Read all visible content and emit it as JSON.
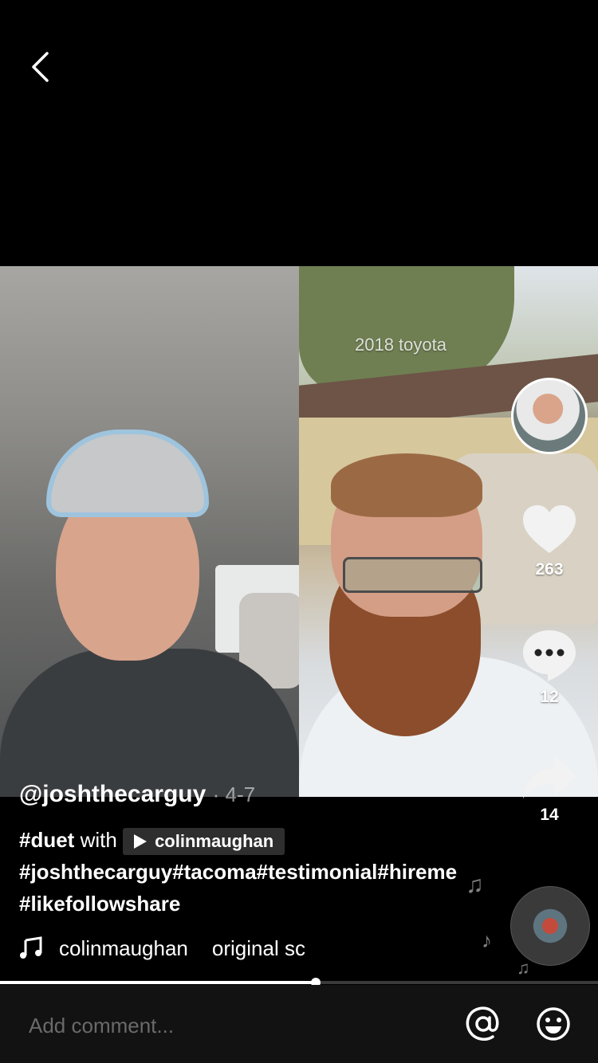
{
  "video": {
    "overlay_text": "2018 toyota"
  },
  "post": {
    "handle": "@joshthecarguy",
    "date": "· 4-7",
    "caption_duet_tag": "#duet",
    "caption_with": "with",
    "duet_user": "colinmaughan",
    "caption_hashtags": "#joshthecarguy#tacoma#testimonial#hireme#likefollowshare"
  },
  "actions": {
    "likes": "263",
    "comments": "12",
    "shares": "14"
  },
  "music": {
    "author": "colinmaughan",
    "title": "original sc"
  },
  "playback": {
    "progress": 0.528
  },
  "comment_bar": {
    "placeholder": "Add comment..."
  },
  "icons": [
    "back-icon",
    "heart-icon",
    "comment-icon",
    "share-icon",
    "music-note-icon",
    "at-icon",
    "emoji-icon",
    "music-disc-icon"
  ]
}
